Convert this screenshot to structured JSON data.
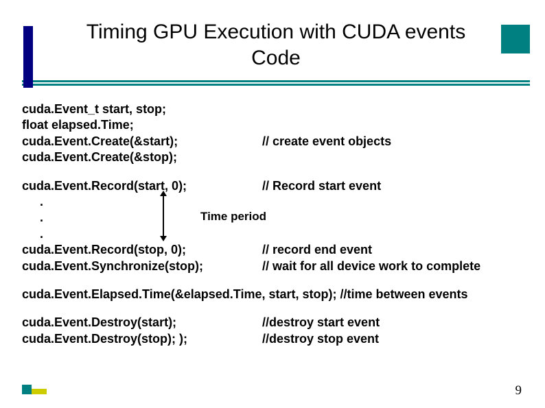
{
  "title_line1": "Timing GPU Execution with CUDA events",
  "title_line2": "Code",
  "block1": {
    "l1": "cuda.Event_t start, stop;",
    "l2": "float elapsed.Time;",
    "l3_left": "cuda.Event.Create(&start);",
    "l3_right": "// create event objects",
    "l4": "cuda.Event.Create(&stop);"
  },
  "block2": {
    "l1_left": "cuda.Event.Record(start, 0);",
    "l1_right": "// Record start event",
    "dot": ".",
    "time_label": "Time period",
    "l5_left": "cuda.Event.Record(stop, 0);",
    "l5_right": "// record end event",
    "l6_left": "cuda.Event.Synchronize(stop);",
    "l6_right": "// wait for all device work to complete"
  },
  "block3": {
    "l1": "cuda.Event.Elapsed.Time(&elapsed.Time, start, stop); //time between events"
  },
  "block4": {
    "l1_left": "cuda.Event.Destroy(start);",
    "l1_right": "//destroy start event",
    "l2_left": "cuda.Event.Destroy(stop); );",
    "l2_right": "//destroy stop event"
  },
  "page_number": "9"
}
